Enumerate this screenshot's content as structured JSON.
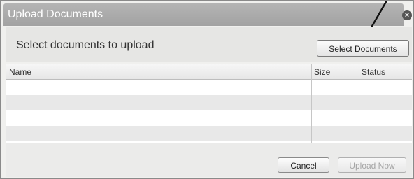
{
  "dialog": {
    "title": "Upload Documents",
    "close_icon": "close-icon"
  },
  "header": {
    "prompt": "Select documents to upload",
    "select_button_label": "Select Documents"
  },
  "table": {
    "columns": [
      "Name",
      "Size",
      "Status"
    ],
    "rows": [
      {
        "name": "",
        "size": "",
        "status": ""
      },
      {
        "name": "",
        "size": "",
        "status": ""
      },
      {
        "name": "",
        "size": "",
        "status": ""
      },
      {
        "name": "",
        "size": "",
        "status": ""
      }
    ]
  },
  "footer": {
    "cancel_label": "Cancel",
    "upload_label": "Upload Now",
    "upload_enabled": false
  },
  "colors": {
    "titlebar": "#a8a8a8",
    "row_alt": "#e8e8e8",
    "disabled_text": "#a5a5a5"
  }
}
